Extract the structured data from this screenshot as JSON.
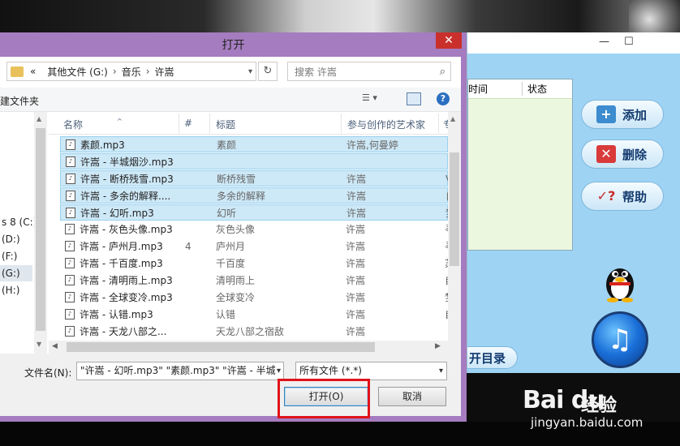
{
  "dialog": {
    "title": "打开",
    "close_glyph": "✕",
    "address": {
      "prefix": "«",
      "path": [
        "其他文件 (G:)",
        "音乐",
        "许嵩"
      ],
      "separator": "›"
    },
    "search_placeholder": "搜索 许嵩",
    "toolbar": {
      "new_folder": "建文件夹"
    },
    "nav_items": [
      {
        "label": "s 8 (C:)",
        "selected": false
      },
      {
        "label": "(D:)",
        "selected": false
      },
      {
        "label": "(F:)",
        "selected": false
      },
      {
        "label": "(G:)",
        "selected": true
      },
      {
        "label": "(H:)",
        "selected": false
      }
    ],
    "columns": {
      "name": "名称",
      "num": "#",
      "title": "标题",
      "artist": "参与创作的艺术家",
      "more": "专"
    },
    "files": [
      {
        "name": "素颜.mp3",
        "num": "",
        "title": "素颜",
        "artist": "许嵩,何曼婷",
        "more": "",
        "selected": true
      },
      {
        "name": "许嵩 - 半城烟沙.mp3",
        "num": "",
        "title": "",
        "artist": "",
        "more": "",
        "selected": true
      },
      {
        "name": "许嵩 - 断桥残雪.mp3",
        "num": "",
        "title": "断桥残雪",
        "artist": "许嵩",
        "more": "V",
        "selected": true
      },
      {
        "name": "许嵩 - 多余的解释....",
        "num": "",
        "title": "多余的解释",
        "artist": "许嵩",
        "more": "自",
        "selected": true
      },
      {
        "name": "许嵩 - 幻听.mp3",
        "num": "",
        "title": "幻听",
        "artist": "许嵩",
        "more": "梦",
        "selected": true
      },
      {
        "name": "许嵩 - 灰色头像.mp3",
        "num": "",
        "title": "灰色头像",
        "artist": "许嵩",
        "more": "寻",
        "selected": false
      },
      {
        "name": "许嵩 - 庐州月.mp3",
        "num": "4",
        "title": "庐州月",
        "artist": "许嵩",
        "more": "寻",
        "selected": false
      },
      {
        "name": "许嵩 - 千百度.mp3",
        "num": "",
        "title": "千百度",
        "artist": "许嵩",
        "more": "苏",
        "selected": false
      },
      {
        "name": "许嵩 - 清明雨上.mp3",
        "num": "",
        "title": "清明雨上",
        "artist": "许嵩",
        "more": "自",
        "selected": false
      },
      {
        "name": "许嵩 - 全球变冷.mp3",
        "num": "",
        "title": "全球变冷",
        "artist": "许嵩",
        "more": "梦",
        "selected": false
      },
      {
        "name": "许嵩 - 认错.mp3",
        "num": "",
        "title": "认错",
        "artist": "许嵩",
        "more": "自",
        "selected": false
      },
      {
        "name": "许嵩 - 天龙八部之...",
        "num": "",
        "title": "天龙八部之宿敌",
        "artist": "许嵩",
        "more": "",
        "selected": false
      }
    ],
    "filename_label": "文件名(N):",
    "filename_value": "\"许嵩 - 幻听.mp3\" \"素颜.mp3\" \"许嵩 - 半城",
    "filetype_value": "所有文件 (*.*)",
    "open_button": "打开(O)",
    "cancel_button": "取消"
  },
  "app": {
    "minimize_glyph": "—",
    "maximize_glyph": "☐",
    "table_headers": {
      "time": "时间",
      "status": "状态"
    },
    "buttons": {
      "add": "添加",
      "delete": "删除",
      "help": "帮助"
    },
    "open_dir": "开目录",
    "itunes_glyph": "♫"
  },
  "watermark": {
    "logo": "Bai du",
    "brand": "经验",
    "url": "jingyan.baidu.com"
  },
  "colors": {
    "dialog_frame": "#a57cbf",
    "selection": "#cde8f6",
    "highlight_box": "#e0131a",
    "close_button": "#c9302c"
  }
}
